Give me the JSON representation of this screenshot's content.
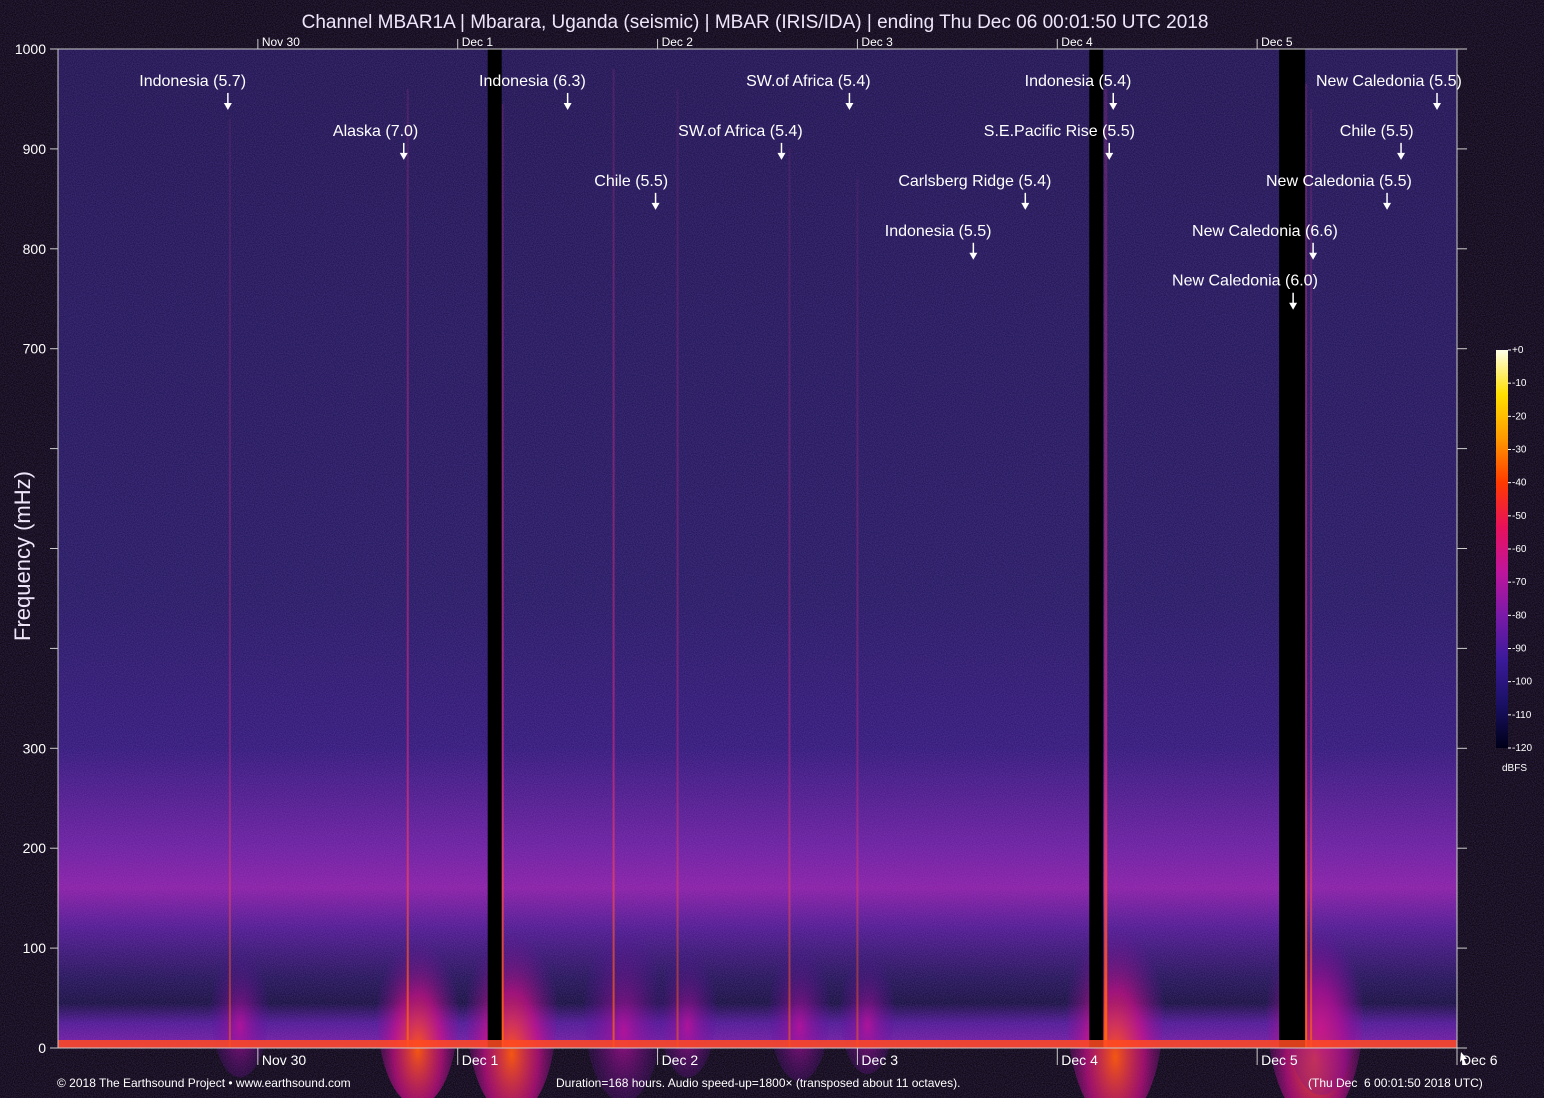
{
  "title": "Channel MBAR1A | Mbarara, Uganda (seismic) | MBAR (IRIS/IDA) | ending Thu Dec 06 00:01:50 UTC 2018",
  "colors": {
    "background": "#000000",
    "plot_background": "#1a1450",
    "text": "#ffffff",
    "arrow": "#ffffff",
    "colormap": [
      "#000018",
      "#1a1065",
      "#3b1a9a",
      "#7a1aa8",
      "#c0159c",
      "#e8115a",
      "#ff3a00",
      "#ff9a00",
      "#ffe000",
      "#ffffe8"
    ]
  },
  "footer": {
    "copyright": "© 2018 The Earthsound Project • www.earthsound.com",
    "duration": "Duration=168 hours. Audio speed-up=1800× (transposed about 11 octaves).",
    "timestamp": "(Thu Dec  6 00:01:50 2018 UTC)"
  },
  "colorbar": {
    "unit": "dBFS",
    "ticks": [
      "+0",
      "-10",
      "-20",
      "-30",
      "-40",
      "-50",
      "-60",
      "-70",
      "-80",
      "-90",
      "-100",
      "-110",
      "-120"
    ]
  },
  "chart_data": {
    "type": "heatmap",
    "title": "Channel MBAR1A | Mbarara, Uganda (seismic) | MBAR (IRIS/IDA) | ending Thu Dec 06 00:01:50 UTC 2018",
    "ylabel": "Frequency (mHz)",
    "ylim": [
      0,
      1000
    ],
    "y_tick_labels": [
      {
        "value": 1000,
        "label": "1000"
      },
      {
        "value": 900,
        "label": "900"
      },
      {
        "value": 800,
        "label": "800"
      },
      {
        "value": 700,
        "label": "700"
      },
      {
        "value": 600,
        "label": ""
      },
      {
        "value": 500,
        "label": ""
      },
      {
        "value": 400,
        "label": ""
      },
      {
        "value": 300,
        "label": "300"
      },
      {
        "value": 200,
        "label": "200"
      },
      {
        "value": 100,
        "label": "100"
      },
      {
        "value": 0,
        "label": "0"
      }
    ],
    "x_unit": "days",
    "xlim": [
      0,
      7
    ],
    "top_date_labels": [
      {
        "x": 1,
        "label": "Nov 30"
      },
      {
        "x": 2,
        "label": "Dec  1"
      },
      {
        "x": 3,
        "label": "Dec  2"
      },
      {
        "x": 4,
        "label": "Dec  3"
      },
      {
        "x": 5,
        "label": "Dec  4"
      },
      {
        "x": 6,
        "label": "Dec  5"
      }
    ],
    "bottom_date_labels": [
      {
        "x": 1,
        "label": "Nov 30"
      },
      {
        "x": 2,
        "label": "Dec  1"
      },
      {
        "x": 3,
        "label": "Dec  2"
      },
      {
        "x": 4,
        "label": "Dec  3"
      },
      {
        "x": 5,
        "label": "Dec  4"
      },
      {
        "x": 6,
        "label": "Dec  5"
      },
      {
        "x": 7,
        "label": "Dec  6"
      }
    ],
    "earthquakes": [
      {
        "label": "Indonesia (5.7)",
        "x": 0.85,
        "freq": 940,
        "level": 0
      },
      {
        "label": "Alaska (7.0)",
        "x": 1.73,
        "freq": 890,
        "level": 1
      },
      {
        "label": "Indonesia (6.3)",
        "x": 2.55,
        "freq": 940,
        "level": 0
      },
      {
        "label": "Chile (5.5)",
        "x": 2.99,
        "freq": 840,
        "level": 2
      },
      {
        "label": "SW.of Africa (5.4)",
        "x": 3.96,
        "freq": 940,
        "level": 0
      },
      {
        "label": "SW.of Africa (5.4)",
        "x": 3.62,
        "freq": 890,
        "level": 1
      },
      {
        "label": "Carlsberg Ridge (5.4)",
        "x": 4.84,
        "freq": 840,
        "level": 2
      },
      {
        "label": "Indonesia (5.5)",
        "x": 4.58,
        "freq": 790,
        "level": 3
      },
      {
        "label": "Indonesia (5.4)",
        "x": 5.28,
        "freq": 940,
        "level": 0
      },
      {
        "label": "S.E.Pacific Rise (5.5)",
        "x": 5.26,
        "freq": 890,
        "level": 1
      },
      {
        "label": "New Caledonia (5.5)",
        "x": 6.9,
        "freq": 940,
        "level": 0
      },
      {
        "label": "Chile (5.5)",
        "x": 6.72,
        "freq": 890,
        "level": 1
      },
      {
        "label": "New Caledonia (5.5)",
        "x": 6.65,
        "freq": 840,
        "level": 2
      },
      {
        "label": "New Caledonia (6.6)",
        "x": 6.28,
        "freq": 790,
        "level": 3
      },
      {
        "label": "New Caledonia (6.0)",
        "x": 6.18,
        "freq": 740,
        "level": 4
      }
    ],
    "signal_lines": [
      {
        "x": 0.86,
        "top_freq": 930,
        "strength": 0.35
      },
      {
        "x": 1.75,
        "top_freq": 960,
        "strength": 0.75
      },
      {
        "x": 2.22,
        "top_freq": 945,
        "strength": 0.9
      },
      {
        "x": 2.78,
        "top_freq": 980,
        "strength": 0.7
      },
      {
        "x": 3.1,
        "top_freq": 960,
        "strength": 0.35
      },
      {
        "x": 3.66,
        "top_freq": 900,
        "strength": 0.4
      },
      {
        "x": 4.0,
        "top_freq": 870,
        "strength": 0.3
      },
      {
        "x": 5.24,
        "top_freq": 960,
        "strength": 1.0
      },
      {
        "x": 6.24,
        "top_freq": 965,
        "strength": 1.0
      },
      {
        "x": 6.27,
        "top_freq": 940,
        "strength": 0.6
      }
    ],
    "data_gaps": [
      {
        "from": 2.15,
        "to": 2.22
      },
      {
        "from": 5.16,
        "to": 5.23
      },
      {
        "from": 6.11,
        "to": 6.24
      }
    ],
    "colorbar_unit": "dBFS",
    "colorbar_range": [
      -120,
      0
    ]
  }
}
